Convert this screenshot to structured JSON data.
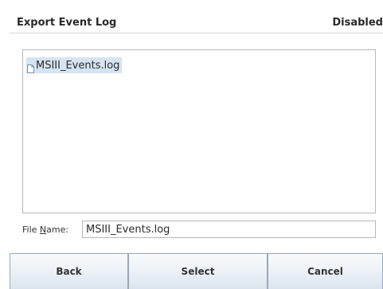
{
  "dialog": {
    "title": "Export Event Log",
    "status": "Disabled"
  },
  "file_list": {
    "items": [
      {
        "label": "MSIII_Events.log",
        "icon": "document-icon",
        "selected": true
      }
    ]
  },
  "filename": {
    "label_prefix": "File ",
    "label_mnemonic": "N",
    "label_suffix": "ame:",
    "value": "MSIII_Events.log"
  },
  "buttons": {
    "back": "Back",
    "select": "Select",
    "cancel": "Cancel"
  },
  "colors": {
    "selection": "#d6e3f2",
    "button_border": "#9aa7b7"
  }
}
